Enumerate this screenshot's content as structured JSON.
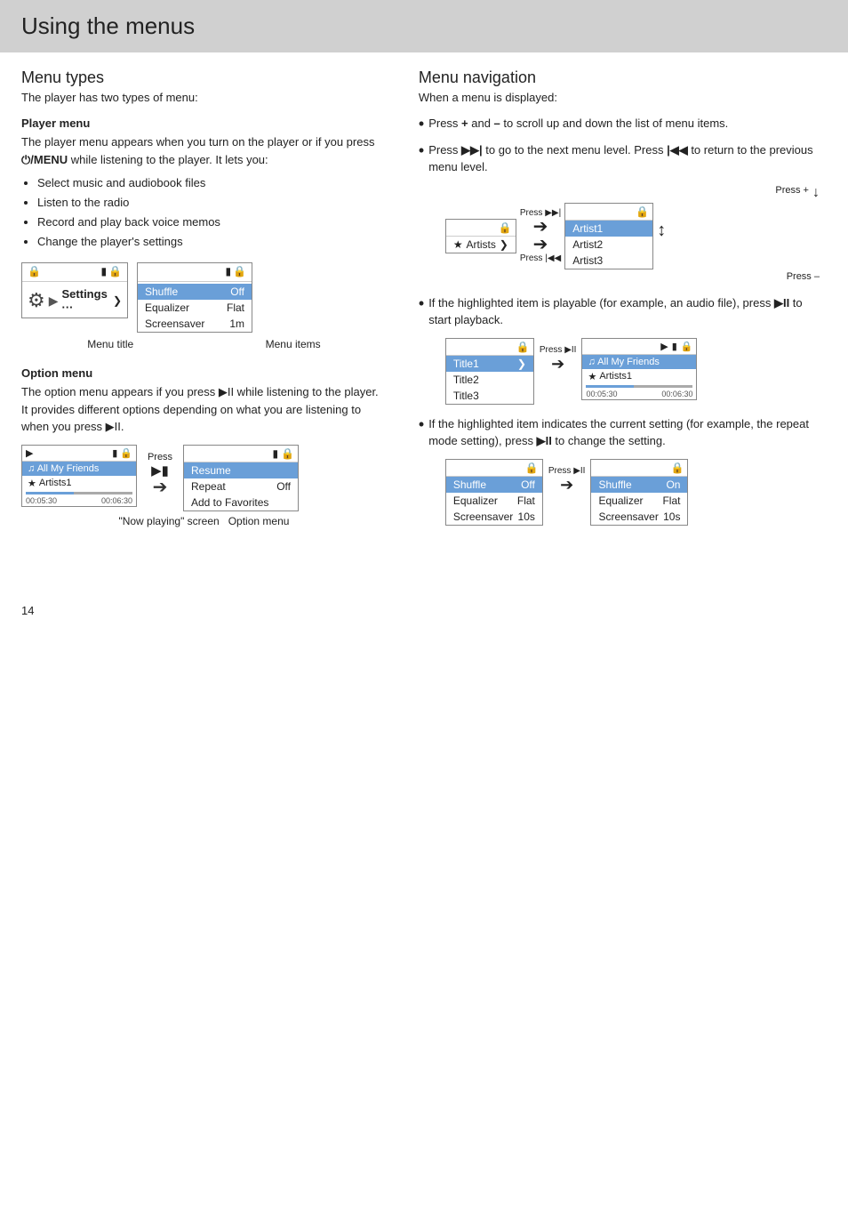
{
  "page": {
    "title": "Using the menus",
    "page_number": "14"
  },
  "left": {
    "section_title": "Menu types",
    "section_subtitle": "The player has two types of menu:",
    "player_menu": {
      "heading": "Player menu",
      "para1": "The player menu appears when you turn on the player or if you press",
      "para1_bold": "⏻/MENU",
      "para1_end": "while listening to the player. It lets you:",
      "bullets": [
        "Select music and audiobook files",
        "Listen to the radio",
        "Record and play back voice memos",
        "Change the player's settings"
      ],
      "menu_title_label": "Menu title",
      "menu_items_label": "Menu items",
      "settings_label": "Settings ···",
      "menu_items": [
        {
          "name": "Shuffle",
          "value": "Off",
          "highlighted": true
        },
        {
          "name": "Equalizer",
          "value": "Flat",
          "highlighted": false
        },
        {
          "name": "Screensaver",
          "value": "1m",
          "highlighted": false
        }
      ]
    },
    "option_menu": {
      "heading": "Option menu",
      "para": "The option menu appears if you press ▶II while listening to the player. It provides different options depending on what you are listening to when you press ▶II.",
      "now_playing_label": "\"Now playing\" screen",
      "option_menu_label": "Option menu",
      "press_label": "Press",
      "press_symbol": "▶II",
      "np_track": "All My Friends",
      "np_artist": "Artists1",
      "np_time1": "00:05:30",
      "np_time2": "00:06:30",
      "opt_items": [
        {
          "name": "Resume",
          "highlighted": true
        },
        {
          "name": "Repeat",
          "value": "Off",
          "highlighted": false
        },
        {
          "name": "Add to Favorites",
          "highlighted": false
        }
      ]
    }
  },
  "right": {
    "section_title": "Menu navigation",
    "section_subtitle": "When a menu is displayed:",
    "bullets": [
      {
        "text": "Press + and – to scroll up and down the list of menu items."
      },
      {
        "text": "Press ▶▶| to go to the next menu level. Press |◀◀ to return to the previous menu level."
      }
    ],
    "nav_diagram": {
      "press_ff": "Press ▶▶|",
      "press_rew": "Press |◀◀",
      "press_plus": "Press +",
      "press_minus": "Press –",
      "source_item": "Artists",
      "dest_items": [
        {
          "name": "Artist1",
          "highlighted": true
        },
        {
          "name": "Artist2",
          "highlighted": false
        },
        {
          "name": "Artist3",
          "highlighted": false
        }
      ]
    },
    "playback_bullet": "If the highlighted item is playable (for example, an audio file), press ▶II to start playback.",
    "playback_diagram": {
      "press_label": "Press ▶II",
      "left_items": [
        {
          "name": "Title1",
          "highlighted": true
        },
        {
          "name": "Title2",
          "highlighted": false
        },
        {
          "name": "Title3",
          "highlighted": false
        }
      ],
      "right_track": "All My Friends",
      "right_artist": "Artists1",
      "right_time1": "00:05:30",
      "right_time2": "00:06:30"
    },
    "setting_bullet": "If the highlighted item indicates the current setting (for example, the repeat mode setting), press ▶II to change the setting.",
    "setting_diagram": {
      "press_label": "Press ▶II",
      "left_items": [
        {
          "name": "Shuffle",
          "value": "Off",
          "highlighted": true
        },
        {
          "name": "Equalizer",
          "value": "Flat",
          "highlighted": false
        },
        {
          "name": "Screensaver",
          "value": "10s",
          "highlighted": false
        }
      ],
      "right_items": [
        {
          "name": "Shuffle",
          "value": "On",
          "highlighted": true
        },
        {
          "name": "Equalizer",
          "value": "Flat",
          "highlighted": false
        },
        {
          "name": "Screensaver",
          "value": "10s",
          "highlighted": false
        }
      ]
    }
  }
}
